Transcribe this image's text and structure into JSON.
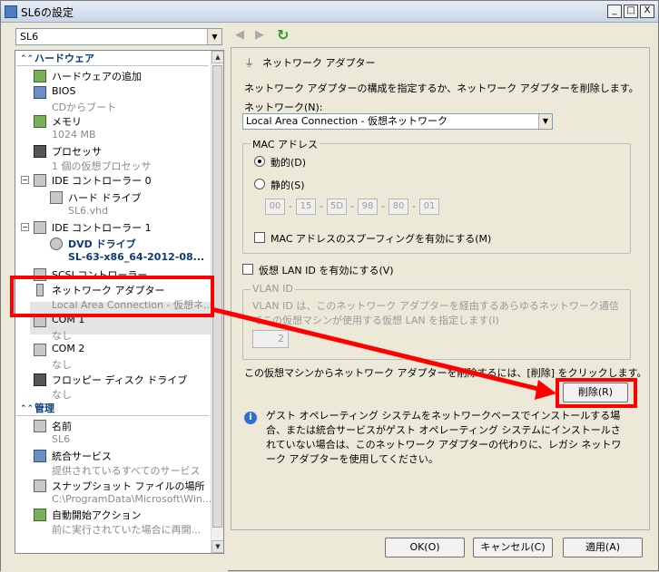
{
  "window": {
    "title": "SL6の設定",
    "min": "_",
    "max": "□",
    "close": "X"
  },
  "vm_selector": {
    "value": "SL6"
  },
  "tree": {
    "hardware_header": "ハードウェア",
    "items": [
      {
        "label": "ハードウェアの追加",
        "sub": ""
      },
      {
        "label": "BIOS",
        "sub": "CDからブート"
      },
      {
        "label": "メモリ",
        "sub": "1024 MB"
      },
      {
        "label": "プロセッサ",
        "sub": "1 個の仮想プロセッサ"
      },
      {
        "label": "IDE コントローラー 0",
        "sub": ""
      },
      {
        "label": "ハード ドライブ",
        "sub": "SL6.vhd"
      },
      {
        "label": "IDE コントローラー 1",
        "sub": ""
      },
      {
        "label": "DVD ドライブ",
        "sub": "SL-63-x86_64-2012-08..."
      },
      {
        "label": "SCSI コントローラー",
        "sub": ""
      },
      {
        "label": "ネットワーク アダプター",
        "sub": "Local Area Connection - 仮想ネ..."
      },
      {
        "label": "COM 1",
        "sub": "なし"
      },
      {
        "label": "COM 2",
        "sub": "なし"
      },
      {
        "label": "フロッピー ディスク ドライブ",
        "sub": "なし"
      }
    ],
    "management_header": "管理",
    "mgmt_items": [
      {
        "label": "名前",
        "sub": "SL6"
      },
      {
        "label": "統合サービス",
        "sub": "提供されているすべてのサービス"
      },
      {
        "label": "スナップショット ファイルの場所",
        "sub": "C:\\ProgramData\\Microsoft\\Win..."
      },
      {
        "label": "自動開始アクション",
        "sub": "前に実行されていた場合に再開..."
      }
    ]
  },
  "panel": {
    "title": "ネットワーク アダプター",
    "description": "ネットワーク アダプターの構成を指定するか、ネットワーク アダプターを削除します。",
    "network_label": "ネットワーク(N):",
    "network_value": "Local Area Connection - 仮想ネットワーク",
    "mac_group": "MAC アドレス",
    "dynamic": "動的(D)",
    "static": "静的(S)",
    "mac": [
      "00",
      "15",
      "5D",
      "98",
      "80",
      "01"
    ],
    "spoofing": "MAC アドレスのスプーフィングを有効にする(M)",
    "vlan_check": "仮想 LAN ID を有効にする(V)",
    "vlan_group": "VLAN ID",
    "vlan_desc": "VLAN ID は、このネットワーク アダプターを経由するあらゆるネットワーク通信でこの仮想マシンが使用する仮想 LAN を指定します(I)",
    "vlan_value": "2",
    "remove_text": "この仮想マシンからネットワーク アダプターを削除するには、[削除] をクリックします。",
    "remove_button": "削除(R)",
    "info_text": "ゲスト オペレーティング システムをネットワークベースでインストールする場合、または統合サービスがゲスト オペレーティング システムにインストールされていない場合は、このネットワーク アダプターの代わりに、レガシ ネットワーク アダプターを使用してください。"
  },
  "footer": {
    "ok": "OK(O)",
    "cancel": "キャンセル(C)",
    "apply": "適用(A)"
  },
  "colors": {
    "highlight": "#ff0000",
    "section": "#0b3a7a"
  }
}
